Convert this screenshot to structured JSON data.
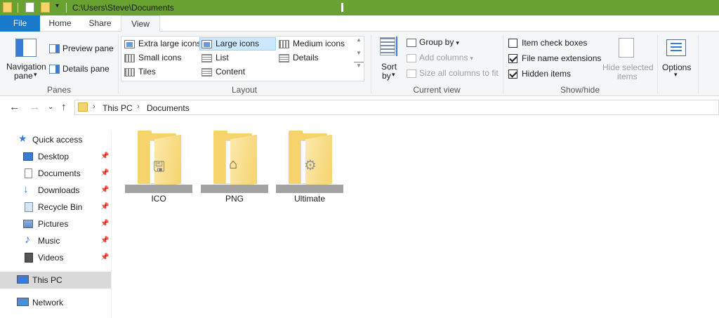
{
  "window": {
    "path": "C:\\Users\\Steve\\Documents"
  },
  "tabs": [
    {
      "label": "File"
    },
    {
      "label": "Home"
    },
    {
      "label": "Share"
    },
    {
      "label": "View"
    }
  ],
  "ribbon": {
    "panes": {
      "label": "Panes",
      "navigation_pane": "Navigation",
      "navigation_pane_line2": "pane",
      "preview_pane": "Preview pane",
      "details_pane": "Details pane"
    },
    "layout": {
      "label": "Layout",
      "items": [
        {
          "label": "Extra large icons"
        },
        {
          "label": "Large icons",
          "selected": true
        },
        {
          "label": "Medium icons"
        },
        {
          "label": "Small icons"
        },
        {
          "label": "List"
        },
        {
          "label": "Details"
        },
        {
          "label": "Tiles"
        },
        {
          "label": "Content"
        }
      ]
    },
    "current_view": {
      "label": "Current view",
      "sort_by": "Sort",
      "sort_by_line2": "by",
      "group_by": "Group by",
      "add_columns": "Add columns",
      "size_all_columns": "Size all columns to fit"
    },
    "show_hide": {
      "label": "Show/hide",
      "item_check_boxes": {
        "label": "Item check boxes",
        "checked": false
      },
      "file_name_extensions": {
        "label": "File name extensions",
        "checked": true
      },
      "hidden_items": {
        "label": "Hidden items",
        "checked": true
      },
      "hide_selected": "Hide selected",
      "hide_selected_line2": "items"
    },
    "options": "Options"
  },
  "address": {
    "crumbs": [
      "This PC",
      "Documents"
    ]
  },
  "nav": {
    "quick_access": "Quick access",
    "items": [
      {
        "label": "Desktop",
        "icon": "desktop-icon"
      },
      {
        "label": "Documents",
        "icon": "documents-icon"
      },
      {
        "label": "Downloads",
        "icon": "downloads-icon"
      },
      {
        "label": "Recycle Bin",
        "icon": "recycle-bin-icon"
      },
      {
        "label": "Pictures",
        "icon": "pictures-icon"
      },
      {
        "label": "Music",
        "icon": "music-icon"
      },
      {
        "label": "Videos",
        "icon": "videos-icon"
      }
    ],
    "this_pc": "This PC",
    "network": "Network"
  },
  "files": [
    {
      "name": "ICO"
    },
    {
      "name": "PNG"
    },
    {
      "name": "Ultimate"
    }
  ],
  "colors": {
    "titlebar": "#6aa231",
    "file_tab": "#1979ca",
    "selection": "#cce8ff",
    "folder": "#f6d36b"
  }
}
